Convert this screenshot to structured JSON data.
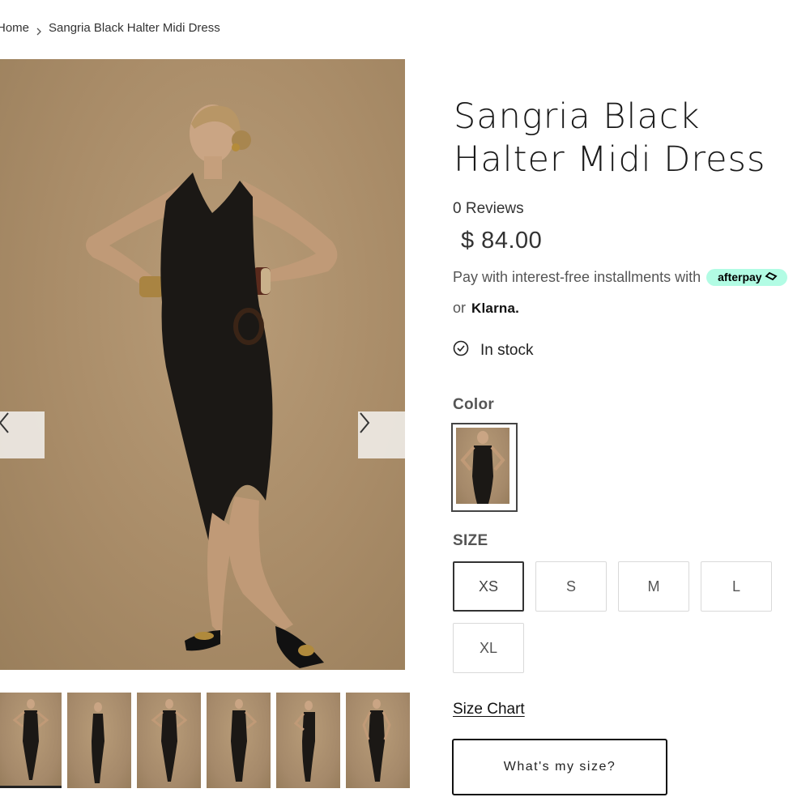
{
  "breadcrumb": {
    "home": "Home",
    "current": "Sangria Black Halter Midi Dress"
  },
  "product": {
    "title_line1": "Sangria Black",
    "title_line2": "Halter Midi Dress",
    "reviews": "0 Reviews",
    "price": "$ 84.00",
    "pay_text": "Pay with interest-free installments with",
    "afterpay_label": "afterpay",
    "or_text": "or",
    "klarna_label": "Klarna.",
    "stock_text": "In stock"
  },
  "gallery": {
    "prev_icon": "chevron-left-icon",
    "next_icon": "chevron-right-icon",
    "thumbnail_count": 6,
    "selected_thumbnail": 1
  },
  "color": {
    "label": "Color",
    "selected": "Sangria Black"
  },
  "size": {
    "label": "SIZE",
    "options": [
      "XS",
      "S",
      "M",
      "L",
      "XL"
    ],
    "selected": "XS",
    "chart_link": "Size Chart",
    "finder_button": "What's my size?"
  },
  "colors": {
    "afterpay_mint": "#b2fce4",
    "background_tan": "#a98c68",
    "dress_black": "#1b1815"
  }
}
